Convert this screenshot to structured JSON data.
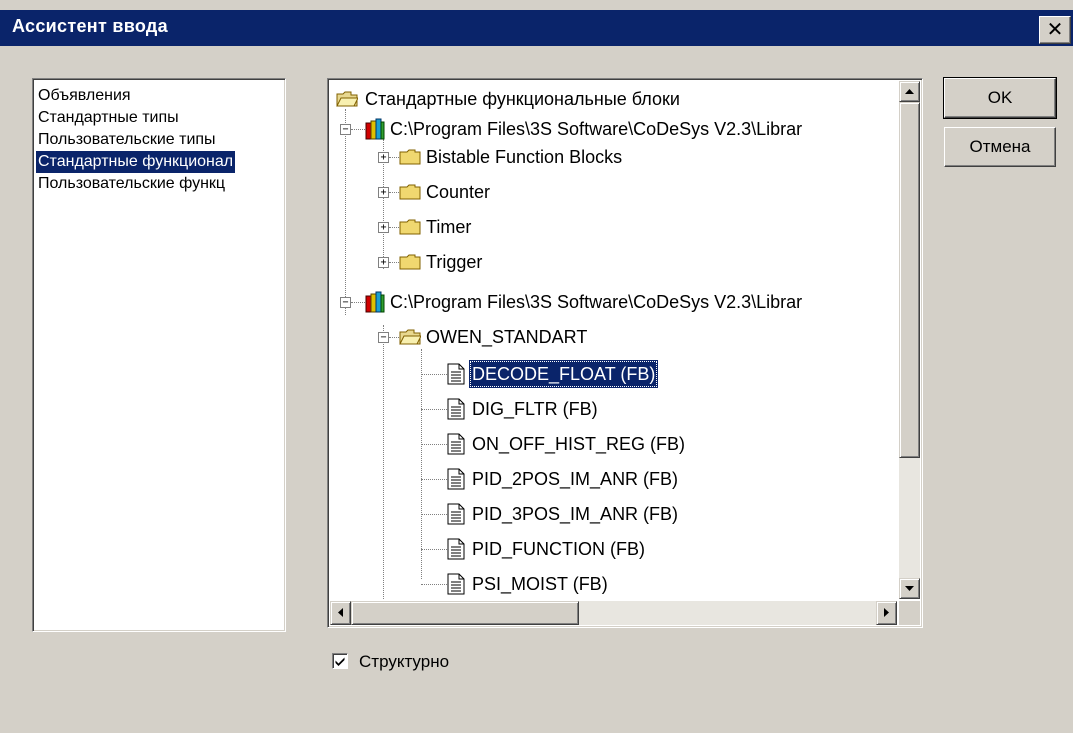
{
  "window": {
    "title": "Ассистент ввода",
    "close_glyph": "✕"
  },
  "categories": [
    {
      "label": "Объявления",
      "selected": false
    },
    {
      "label": "Стандартные типы",
      "selected": false
    },
    {
      "label": "Пользовательские типы",
      "selected": false
    },
    {
      "label": "Стандартные функционал",
      "selected": true
    },
    {
      "label": "Пользовательские функц",
      "selected": false
    }
  ],
  "tree": {
    "root": "Стандартные функциональные блоки",
    "lib1": {
      "path": "C:\\Program Files\\3S Software\\CoDeSys V2.3\\Librar",
      "children": [
        "Bistable Function Blocks",
        "Counter",
        "Timer",
        "Trigger"
      ]
    },
    "lib2": {
      "path": "C:\\Program Files\\3S Software\\CoDeSys V2.3\\Librar",
      "folder": "OWEN_STANDART",
      "items": [
        "DECODE_FLOAT (FB)",
        "DIG_FLTR (FB)",
        "ON_OFF_HIST_REG (FB)",
        "PID_2POS_IM_ANR (FB)",
        "PID_3POS_IM_ANR (FB)",
        "PID_FUNCTION (FB)",
        "PSI_MOIST (FB)"
      ],
      "selected_item": "DECODE_FLOAT (FB)"
    }
  },
  "buttons": {
    "ok": "OK",
    "cancel": "Отмена"
  },
  "structured_checkbox": {
    "label": "Структурно",
    "checked": true,
    "mark": "✔"
  },
  "icons": {
    "root": "folder-open-icon",
    "library": "library-books-icon",
    "folder": "folder-icon",
    "file": "document-icon"
  }
}
